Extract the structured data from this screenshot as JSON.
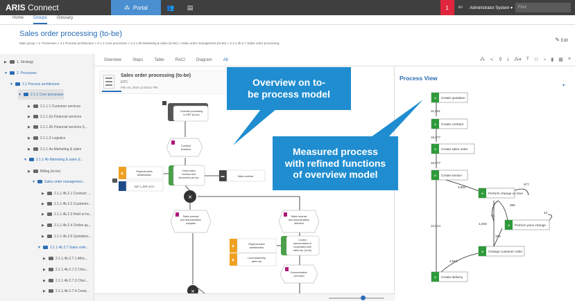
{
  "header": {
    "brand_bold": "ARIS",
    "brand_rest": " Connect",
    "portal_label": "Portal",
    "notification_count": "1",
    "language": "en",
    "user": "Administrator System",
    "find_placeholder": "Find"
  },
  "subnav": {
    "items": [
      "Home",
      "Groups",
      "Glossary"
    ]
  },
  "page": {
    "title": "Sales order processing (to-be)",
    "breadcrumb": "Main group  >  2. Processes  >  2.1 Process architecture  >  2.1.1 Core processes  >  2.1.1.4b Marketing & sales (to-be)  >  Sales order management (to-be)  >  2.1.1.4b.2.7 Sales order processing",
    "edit_label": "Edit"
  },
  "sidebar": {
    "items": [
      {
        "label": "1. Strategy"
      },
      {
        "label": "2. Processes"
      },
      {
        "label": "2.1 Process architecture"
      },
      {
        "label": "2.1.1 Core processes"
      },
      {
        "label": "2.1.1.1 Customer services"
      },
      {
        "label": "2.1.1.2a Financial services"
      },
      {
        "label": "2.1.1.2b Financial services (t..."
      },
      {
        "label": "2.1.1.3 Logistics"
      },
      {
        "label": "2.1.1.4a Marketing & sales"
      },
      {
        "label": "2.1.1.4b Marketing & sales (t..."
      },
      {
        "label": "Billing (to-be)"
      },
      {
        "label": "Sales order managemen..."
      },
      {
        "label": "2.1.1.4b.2.1 Contract ..."
      },
      {
        "label": "2.1.1.4b.2.2 Customer..."
      },
      {
        "label": "2.1.1.4b.2.3 Hold in-ho..."
      },
      {
        "label": "2.1.1.4b.2.4 Online qu..."
      },
      {
        "label": "2.1.1.4b.2.6 Quotation..."
      },
      {
        "label": "2.1.1.4b.2.7 Sales orde..."
      },
      {
        "label": "2.1.1.4b.2.7.1 Alloc..."
      },
      {
        "label": "2.1.1.4b.2.7.2 Chec..."
      },
      {
        "label": "2.1.1.4b.2.7.3 Chec..."
      },
      {
        "label": "2.1.1.4b.2.7.4 Creat..."
      },
      {
        "label": "2.1.1.4b.2.7.5 Creat..."
      }
    ]
  },
  "tabs": [
    "Overview",
    "Steps",
    "Table",
    "RACI",
    "Diagram",
    "Alt"
  ],
  "model": {
    "name": "Sales order processing (to-be)",
    "type": "EPC",
    "date": "Feb 16, 2016 12:50:51 PM"
  },
  "callouts": {
    "first": [
      "Overview on to-",
      "be process model"
    ],
    "second": [
      "Measured process",
      "with refined functions",
      "of overview model"
    ]
  },
  "epc": {
    "f1": [
      "Contract processing",
      "in ERP (to-be)"
    ],
    "e1": [
      "Contract",
      "finalized"
    ],
    "f2": [
      "Check sales",
      "contract and",
      "documents (to-be)"
    ],
    "org1": [
      "Regional sales",
      "administrator"
    ],
    "sys1": "SAP Z_ERP_ECC",
    "doc1": "Sales contract",
    "e2": [
      "Sales contract",
      "and documentation",
      "complete"
    ],
    "e3": [
      "Sales contract",
      "and documentation",
      "deficient"
    ],
    "f3": [
      "Correct",
      "documentation in",
      "cooperation with",
      "sales rep. (to-be)"
    ],
    "org2": [
      "Regional sales",
      "administrator"
    ],
    "org3": [
      "Local dealership",
      "sales rep"
    ],
    "e4": [
      "Documentation",
      "corrected"
    ]
  },
  "process_view": {
    "title": "Process View",
    "steps": [
      "Create quotation",
      "Create contract",
      "Create sales order",
      "Create invoice",
      "Perform change on time",
      "Perform price change",
      "Change customer order",
      "Create delivery"
    ],
    "counts": {
      "c1": "11,244",
      "c2": "16,077",
      "c3": "16,077",
      "c4": "3,563",
      "c5": "977",
      "c6": "389",
      "c7": "42",
      "c8": "84",
      "c9": "3,258",
      "c10": "305",
      "c11": "12,514",
      "c12": "3,563"
    }
  },
  "colors": {
    "accent": "#2a6db5",
    "callout": "#1f8dd0",
    "event": "#b0177a",
    "function_dark": "#555555",
    "function_light": "#ffffff",
    "org": "#f0a020",
    "system": "#1e4b87",
    "pv_step": "#2e9a3a",
    "notification": "#e0263c"
  }
}
